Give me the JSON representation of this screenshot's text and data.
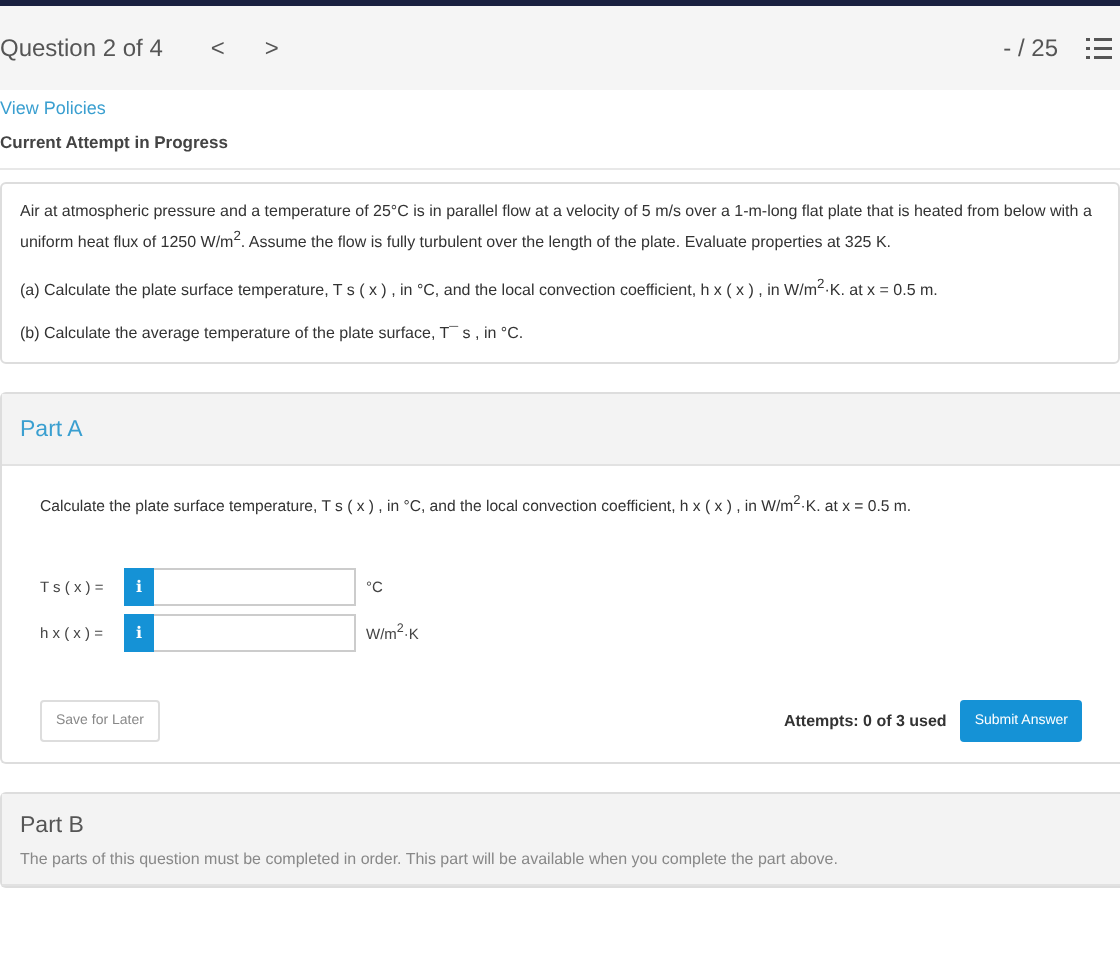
{
  "header": {
    "title": "Question 2 of 4",
    "prev": "<",
    "next": ">",
    "score": "- / 25"
  },
  "links": {
    "policies": "View Policies",
    "status": "Current Attempt in Progress"
  },
  "problem": {
    "paragraphs": [
      "Air at atmospheric pressure and a temperature of 25°C is in parallel flow at a velocity of 5 m/s over a 1-m-long flat plate that is heated from below with a uniform heat flux of 1250 W/m$^{2}$. Assume the flow is fully turbulent over the length of the plate. Evaluate properties at 325 K.",
      "(a) Calculate the plate surface temperature, T s ( x ) , in °C, and the local convection coefficient, h x ( x ) , in W/m$^{2}$·K. at x = 0.5 m.",
      "(b) Calculate the average temperature of the plate surface, T¯ s , in °C."
    ]
  },
  "parts": [
    {
      "title": "Part A",
      "locked": false,
      "prompt": "Calculate the plate surface temperature, T s ( x ) , in °C, and the local convection coefficient, h x ( x ) , in W/m$^{2}$·K. at x = 0.5 m.",
      "answers": [
        {
          "label": "T s ( x ) =",
          "info": "i",
          "unit": "°C"
        },
        {
          "label": "h x ( x ) =",
          "info": "i",
          "unit": "W/m$^{2}$·K"
        }
      ],
      "save": "Save for Later",
      "attempts": "Attempts: 0 of 3 used",
      "submit": "Submit Answer"
    },
    {
      "title": "Part B",
      "locked": true,
      "prompt": "The parts of this question must be completed in order. This part will be available when you complete the part above."
    }
  ]
}
